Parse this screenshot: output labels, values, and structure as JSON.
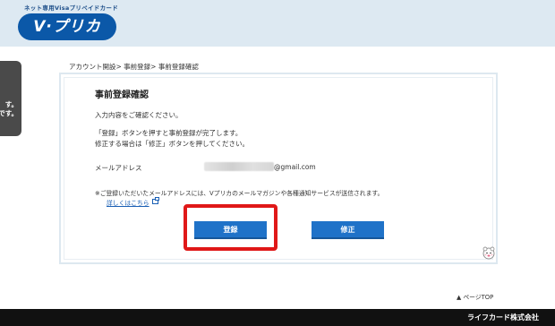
{
  "header": {
    "tagline": "ネット専用Visaプリペイドカード",
    "logo_text": "V·プリカ",
    "background": "#dde9f2",
    "logo_color": "#0b58a8"
  },
  "side_tab": {
    "line1": "す。",
    "line2": "です。"
  },
  "breadcrumb": {
    "text": "アカウント開設> 事前登録> 事前登録確認"
  },
  "main": {
    "title": "事前登録確認",
    "intro": "入力内容をご確認ください。",
    "instruction_line1": "「登録」ボタンを押すと事前登録が完了します。",
    "instruction_line2": "修正する場合は「修正」ボタンを押してください。",
    "email_label": "メールアドレス",
    "email_value": "@gmail.com",
    "notice": "※ご登録いただいたメールアドレスには、Vプリカのメールマガジンや各種通知サービスが送信されます。",
    "details_link": "詳しくはこちら",
    "register_button": "登録",
    "edit_button": "修正",
    "button_color": "#1f72c8",
    "highlight_color": "#e01818"
  },
  "page_top": {
    "label": "ページTOP"
  },
  "footer": {
    "company": "ライフカード株式会社"
  }
}
